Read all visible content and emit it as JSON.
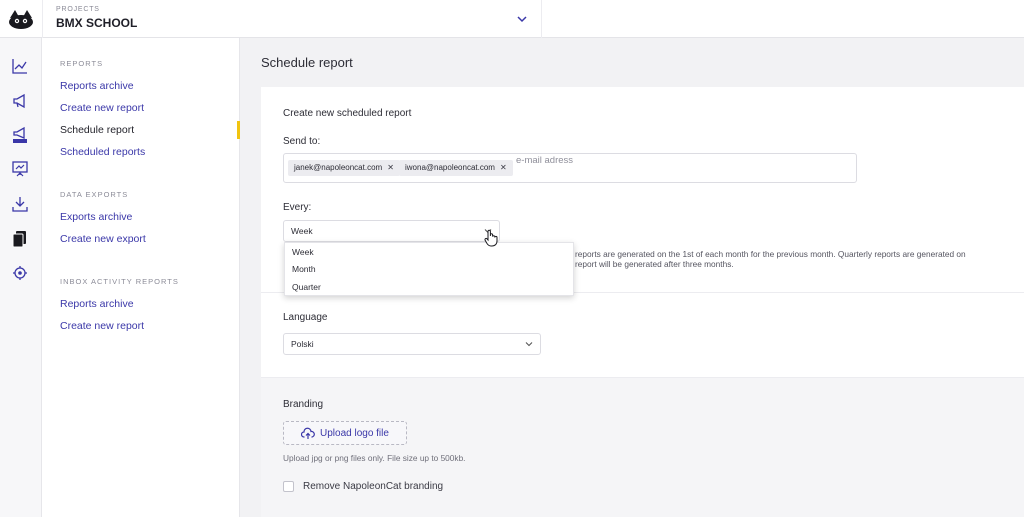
{
  "header": {
    "project_caption": "PROJECTS",
    "project_name": "BMX SCHOOL"
  },
  "rail": {
    "icons": [
      "analytics-icon",
      "megaphone-icon",
      "new-campaign-icon",
      "presentation-icon",
      "download-icon",
      "reports-icon",
      "team-settings-icon"
    ]
  },
  "nav": {
    "reports_heading": "REPORTS",
    "reports_links": [
      "Reports archive",
      "Create new report",
      "Schedule report",
      "Scheduled reports"
    ],
    "data_exports_heading": "DATA EXPORTS",
    "data_exports_links": [
      "Exports archive",
      "Create new export"
    ],
    "inbox_heading": "INBOX ACTIVITY REPORTS",
    "inbox_links": [
      "Reports archive",
      "Create new report"
    ],
    "active_marker_color": "#f1c40f"
  },
  "main": {
    "page_title": "Schedule report",
    "form_title": "Create new scheduled report",
    "send_to_label": "Send to:",
    "recipients": [
      "janek@napoleoncat.com",
      "iwona@napoleoncat.com"
    ],
    "email_placeholder": "e-mail adress",
    "every_label": "Every:",
    "every_value": "Week",
    "every_options": [
      "Week",
      "Month",
      "Quarter"
    ],
    "info_line1": "reports are generated on the 1st of each month for the previous month. Quarterly reports are generated on",
    "info_line2": "report will be generated after three months.",
    "language_label": "Language",
    "language_value": "Polski",
    "branding_label": "Branding",
    "upload_label": "Upload logo file",
    "upload_hint": "Upload jpg or png files only. File size up to 500kb.",
    "remove_branding_label": "Remove NapoleonCat branding"
  },
  "colors": {
    "link": "#3a37a8",
    "accent": "#f1c40f"
  }
}
